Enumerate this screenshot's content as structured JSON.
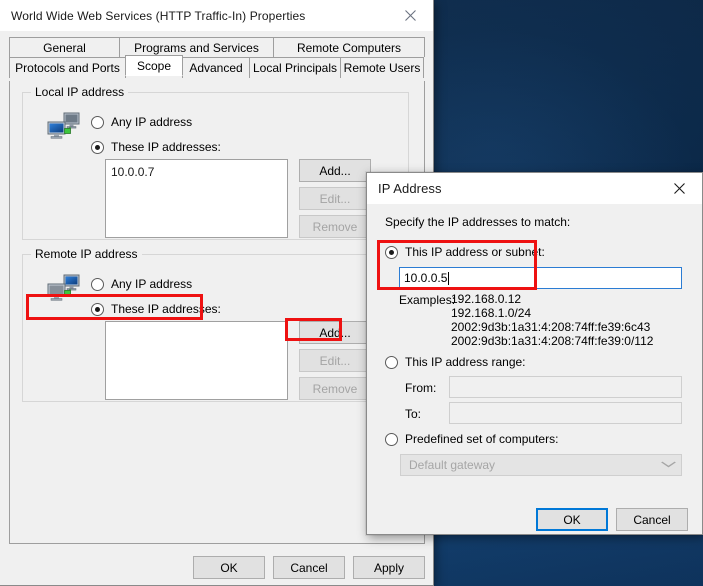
{
  "desktop": {
    "name": "windows-desktop-wallpaper"
  },
  "main_dialog": {
    "title": "World Wide Web Services (HTTP Traffic-In) Properties",
    "close_label": "✕",
    "tabs_row1": [
      {
        "label": "General",
        "selected": false
      },
      {
        "label": "Programs and Services",
        "selected": false
      },
      {
        "label": "Remote Computers",
        "selected": false
      }
    ],
    "tabs_row2": [
      {
        "label": "Protocols and Ports",
        "selected": false
      },
      {
        "label": "Scope",
        "selected": true
      },
      {
        "label": "Advanced",
        "selected": false
      },
      {
        "label": "Local Principals",
        "selected": false
      },
      {
        "label": "Remote Users",
        "selected": false
      }
    ],
    "local_group": {
      "legend": "Local IP address",
      "any_label": "Any IP address",
      "these_label": "These IP addresses:",
      "any_checked": false,
      "these_checked": true,
      "addresses": [
        "10.0.0.7"
      ],
      "add_label": "Add...",
      "edit_label": "Edit...",
      "remove_label": "Remove"
    },
    "remote_group": {
      "legend": "Remote IP address",
      "any_label": "Any IP address",
      "these_label": "These IP addresses:",
      "any_checked": false,
      "these_checked": true,
      "addresses": [],
      "add_label": "Add...",
      "edit_label": "Edit...",
      "remove_label": "Remove"
    },
    "footer": {
      "ok_label": "OK",
      "cancel_label": "Cancel",
      "apply_label": "Apply"
    }
  },
  "ip_dialog": {
    "title": "IP Address",
    "close_label": "✕",
    "instruction": "Specify the IP addresses to match:",
    "subnet_option": {
      "label": "This IP address or subnet:",
      "checked": true,
      "value": "10.0.0.5"
    },
    "examples_label": "Examples:",
    "examples": [
      "192.168.0.12",
      "192.168.1.0/24",
      "2002:9d3b:1a31:4:208:74ff:fe39:6c43",
      "2002:9d3b:1a31:4:208:74ff:fe39:0/112"
    ],
    "range_option": {
      "label": "This IP address range:",
      "checked": false,
      "from_label": "From:",
      "from_value": "",
      "to_label": "To:",
      "to_value": ""
    },
    "predefined_option": {
      "label": "Predefined set of computers:",
      "checked": false,
      "selected": "Default gateway"
    },
    "footer": {
      "ok_label": "OK",
      "cancel_label": "Cancel"
    }
  },
  "annotations": {
    "highlight_color": "#ee1111",
    "boxes": [
      "remote-these-ip-addresses-radio",
      "remote-add-button",
      "subnet-radio-and-value"
    ]
  }
}
